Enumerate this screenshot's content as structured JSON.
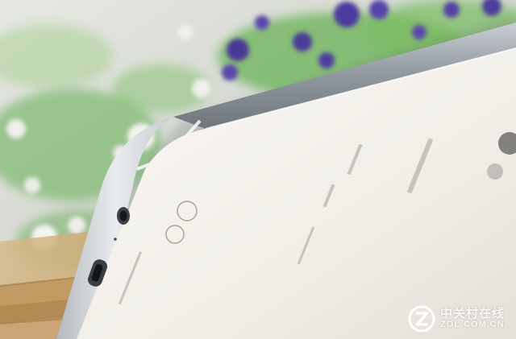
{
  "watermark": {
    "brand_cn": "中关村在线",
    "brand_en": "ZOL.COM.CN",
    "logo_icon": "zol-logo-icon"
  },
  "colors": {
    "phone_body": "#f3f1ec",
    "phone_frame": "#8d9399",
    "wood": "#c9a06a",
    "leaves": "#5aa64a",
    "flowers": "#4b3b9e"
  }
}
